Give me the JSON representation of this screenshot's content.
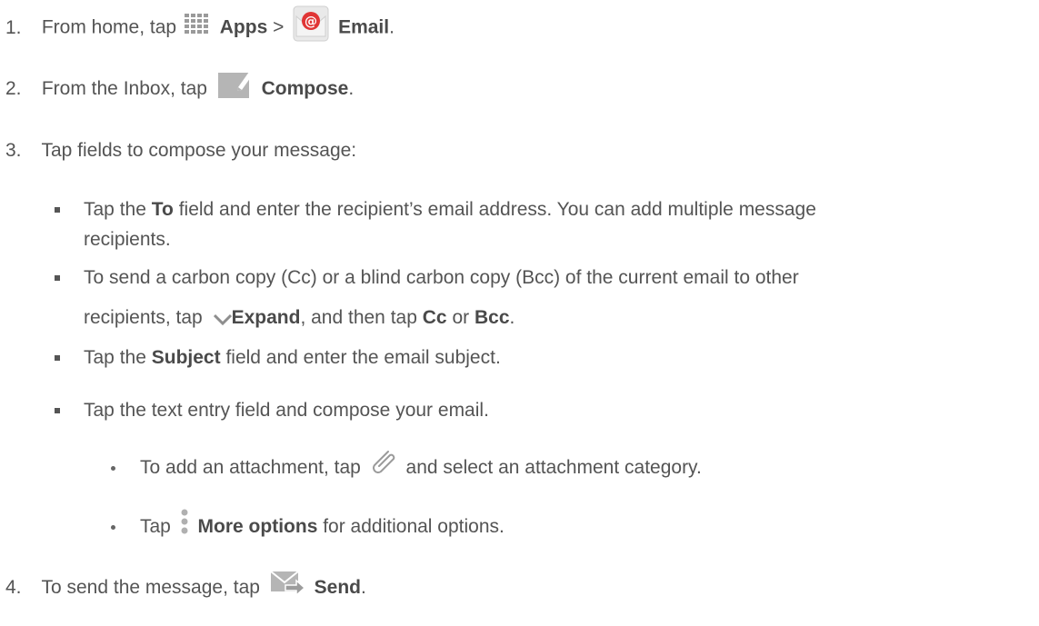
{
  "steps": {
    "s1": {
      "num": "1.",
      "pre": "From home, tap",
      "apps": "Apps",
      "gt": ">",
      "email": "Email",
      "end": "."
    },
    "s2": {
      "num": "2.",
      "pre": "From the Inbox, tap",
      "compose": "Compose",
      "end": "."
    },
    "s3": {
      "num": "3.",
      "text": "Tap fields to compose your message:"
    },
    "s4": {
      "num": "4.",
      "pre": "To send the message, tap",
      "send": "Send",
      "end": "."
    }
  },
  "bullets": {
    "to_pre": "Tap the",
    "to": "To",
    "to_post": "field and enter the recipient’s email address. You can add multiple message",
    "to_line2": "recipients.",
    "cc_line1": "To send a carbon copy (Cc) or a blind carbon copy (Bcc) of the current email to other",
    "cc_pre": "recipients, tap",
    "expand": "Expand",
    "cc_mid": ", and then tap",
    "cc": "Cc",
    "or": "or",
    "bcc": "Bcc",
    "cc_end": ".",
    "subj_pre": "Tap the",
    "subject": "Subject",
    "subj_post": "field and enter the email subject.",
    "text_entry": "Tap the text entry field and compose your email."
  },
  "subbullets": {
    "attach_pre": "To add an attachment, tap",
    "attach_post": "and select an attachment category.",
    "more_pre": "Tap",
    "more": "More options",
    "more_post": "for additional options."
  },
  "icons": {
    "apps": "apps-grid-icon",
    "email": "email-app-icon",
    "compose": "compose-icon",
    "expand": "chevron-down-icon",
    "attach": "paperclip-icon",
    "more": "more-options-icon",
    "send": "send-icon"
  }
}
